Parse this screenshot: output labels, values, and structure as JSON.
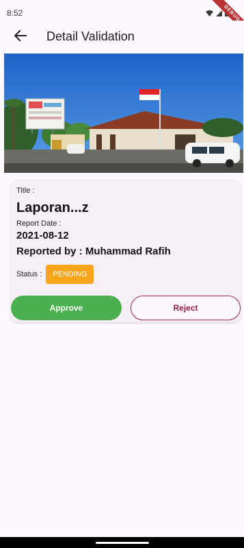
{
  "status_bar": {
    "time": "8:52",
    "debug_banner": "DEBUG"
  },
  "app_bar": {
    "title": "Detail Validation",
    "back_icon": "arrow-back-icon"
  },
  "report": {
    "title_label": "Title :",
    "title_value": "Laporan...z",
    "date_label": "Report Date :",
    "date_value": "2021-08-12",
    "reported_by": "Reported by : Muhammad Rafih",
    "status_label": "Status :",
    "status_value": "PENDING"
  },
  "actions": {
    "approve_label": "Approve",
    "reject_label": "Reject"
  },
  "colors": {
    "background": "#fdf7fe",
    "card": "#f6eff7",
    "pending": "#f9a51a",
    "approve": "#4caf50",
    "reject": "#8e1c3f"
  }
}
